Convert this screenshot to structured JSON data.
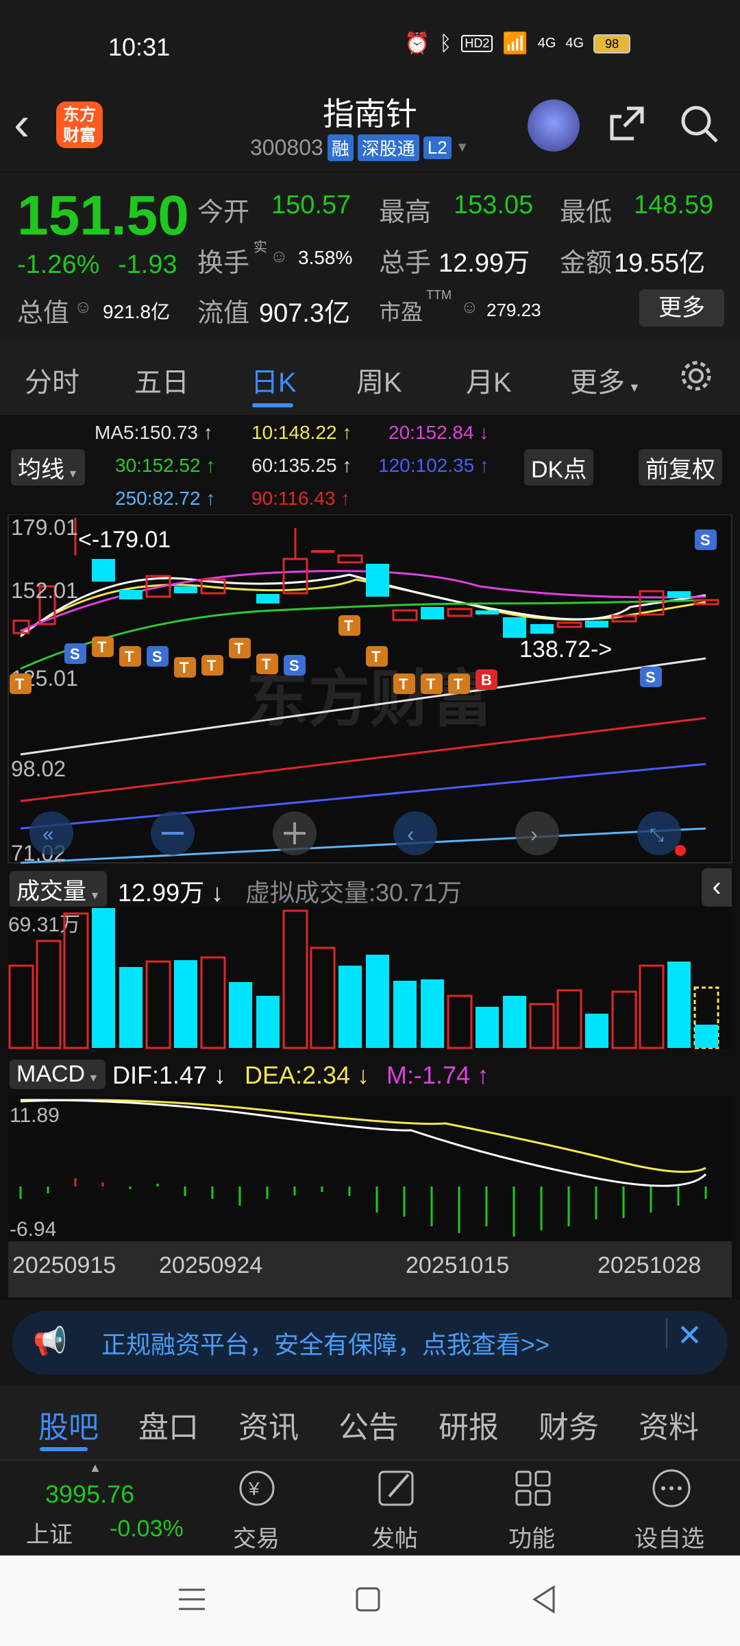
{
  "status": {
    "time": "10:31",
    "battery": "98",
    "hd": "HD2",
    "net1": "4G",
    "net2": "4G"
  },
  "header": {
    "name": "指南针",
    "code": "300803",
    "tags": [
      "融",
      "深股通",
      "L2"
    ],
    "logo_text": "东方财富"
  },
  "quote": {
    "price": "151.50",
    "change_pct": "-1.26%",
    "change_abs": "-1.93",
    "open_label": "今开",
    "open": "150.57",
    "high_label": "最高",
    "high": "153.05",
    "low_label": "最低",
    "low": "148.59",
    "turnover_label": "换手",
    "turnover_sup": "实",
    "turnover": "3.58%",
    "volume_label": "总手",
    "volume": "12.99万",
    "amount_label": "金额",
    "amount": "19.55亿",
    "mktcap_label": "总值",
    "mktcap": "921.8亿",
    "float_label": "流值",
    "float": "907.3亿",
    "pe_label": "市盈",
    "pe_sup": "TTM",
    "pe": "279.23",
    "more": "更多"
  },
  "tabs": [
    "分时",
    "五日",
    "日K",
    "周K",
    "月K",
    "更多"
  ],
  "active_tab": "日K",
  "chart": {
    "ma_button": "均线",
    "dk_button": "DK点",
    "adj_button": "前复权",
    "ma_labels": [
      {
        "text": "MA5:150.73 ↑",
        "color": "#ffffff"
      },
      {
        "text": "10:148.22 ↑",
        "color": "#f5e64b"
      },
      {
        "text": "20:152.84 ↓",
        "color": "#e040e0"
      },
      {
        "text": "30:152.52 ↑",
        "color": "#2ec82e"
      },
      {
        "text": "60:135.25 ↑",
        "color": "#e6e6e6"
      },
      {
        "text": "120:102.35 ↑",
        "color": "#4a5cff"
      },
      {
        "text": "250:82.72 ↑",
        "color": "#5ab4ff"
      },
      {
        "text": "90:116.43 ↑",
        "color": "#e0262a"
      }
    ],
    "y_ticks": [
      "179.01",
      "152.01",
      "125.01",
      "98.02",
      "71.02"
    ],
    "high_marker": "<-179.01",
    "low_marker": "138.72->",
    "watermark": "东方财富"
  },
  "volume": {
    "button": "成交量",
    "value": "12.99万 ↓",
    "virtual": "虚拟成交量:30.71万",
    "max": "69.31万"
  },
  "macd": {
    "button": "MACD",
    "dif": "DIF:1.47 ↓",
    "dea": "DEA:2.34 ↓",
    "m": "M:-1.74 ↑",
    "top": "11.89",
    "bottom": "-6.94"
  },
  "dates": [
    "20250915",
    "20250924",
    "20251015",
    "20251028"
  ],
  "promo": "正规融资平台，安全有保障，点我查看>>",
  "bottom_tabs": [
    "股吧",
    "盘口",
    "资讯",
    "公告",
    "研报",
    "财务",
    "资料"
  ],
  "toolbar": {
    "index_value": "3995.76",
    "index_name": "上证",
    "index_change": "-0.03%",
    "items": [
      "交易",
      "发帖",
      "功能",
      "设自选"
    ]
  },
  "colors": {
    "up": "#e0262a",
    "down": "#00e5ff",
    "green": "#1ec81e",
    "accent": "#3c8dff"
  }
}
